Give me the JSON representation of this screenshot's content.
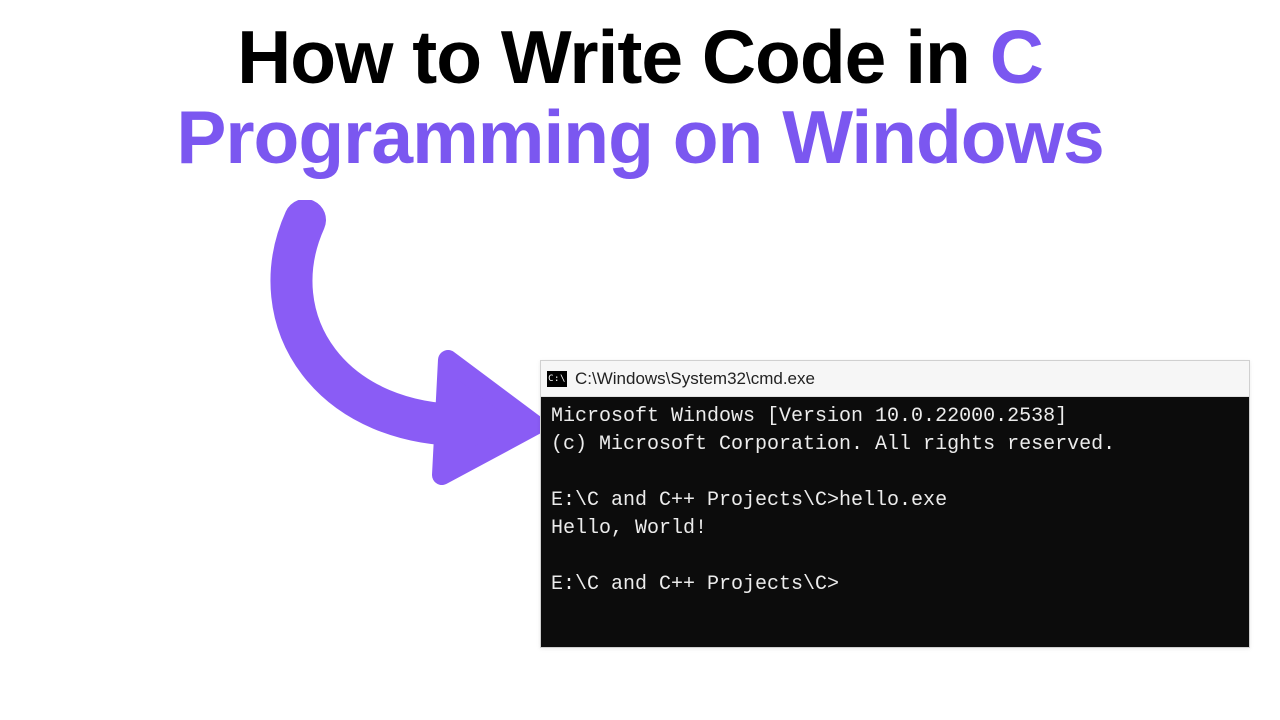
{
  "title": {
    "part1": "How to Write Code in ",
    "part2": "C",
    "part3": "Programming on Windows"
  },
  "cmd": {
    "icon_text": "C:\\",
    "title": "C:\\Windows\\System32\\cmd.exe",
    "lines": {
      "l1": "Microsoft Windows [Version 10.0.22000.2538]",
      "l2": "(c) Microsoft Corporation. All rights reserved.",
      "l3": "",
      "l4": "E:\\C and C++ Projects\\C>hello.exe",
      "l5": "Hello, World!",
      "l6": "",
      "l7": "E:\\C and C++ Projects\\C>"
    }
  },
  "colors": {
    "purple": "#7b57f0",
    "cmd_bg": "#0c0c0c",
    "cmd_fg": "#ececec"
  }
}
